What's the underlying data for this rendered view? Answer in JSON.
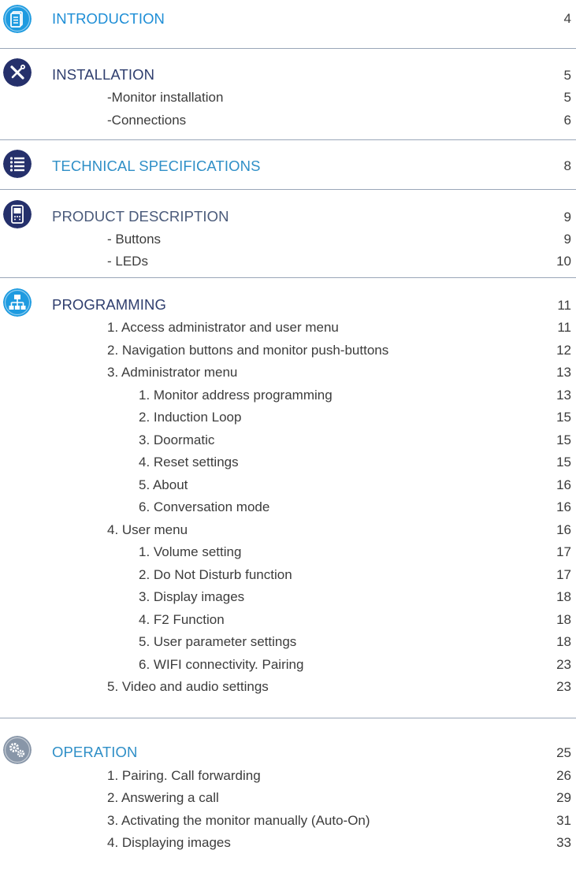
{
  "colors": {
    "introduction_icon": "#1e9be0",
    "installation_icon": "#25306b",
    "technical_icon": "#25306b",
    "product_icon": "#25306b",
    "programming_icon": "#1e9be0",
    "operation_icon": "#8896a8",
    "rule": "#9aa6b8"
  },
  "sections": {
    "introduction": {
      "icon": "document-icon",
      "title": "INTRODUCTION",
      "page": "4"
    },
    "installation": {
      "icon": "tools-icon",
      "title": "INSTALLATION",
      "page": "5",
      "items": [
        {
          "label": "-Monitor installation",
          "page": "5"
        },
        {
          "label": "-Connections",
          "page": "6"
        }
      ]
    },
    "technical": {
      "icon": "list-icon",
      "title": "TECHNICAL SPECIFICATIONS",
      "page": "8"
    },
    "product": {
      "icon": "monitor-icon",
      "title": "PRODUCT DESCRIPTION",
      "page": "9",
      "items": [
        {
          "label": "- Buttons",
          "page": "9"
        },
        {
          "label": "- LEDs",
          "page": "10"
        }
      ]
    },
    "programming": {
      "icon": "network-icon",
      "title": "PROGRAMMING",
      "page": "11",
      "items": [
        {
          "label": "1. Access administrator and user menu",
          "page": "11"
        },
        {
          "label": "2. Navigation buttons and monitor push-buttons",
          "page": "12"
        },
        {
          "label": "3. Administrator menu",
          "page": "13"
        },
        {
          "label": "1. Monitor address programming",
          "page": "13"
        },
        {
          "label": "2. Induction Loop",
          "page": "15"
        },
        {
          "label": "3. Doormatic",
          "page": "15"
        },
        {
          "label": "4. Reset settings",
          "page": "15"
        },
        {
          "label": "5. About",
          "page": "16"
        },
        {
          "label": "6. Conversation mode",
          "page": "16"
        },
        {
          "label": "4. User menu",
          "page": "16"
        },
        {
          "label": "1. Volume setting",
          "page": "17"
        },
        {
          "label": "2. Do Not Disturb function",
          "page": "17"
        },
        {
          "label": "3. Display images",
          "page": "18"
        },
        {
          "label": "4. F2 Function",
          "page": "18"
        },
        {
          "label": "5. User parameter settings",
          "page": "18"
        },
        {
          "label": "6. WIFI connectivity. Pairing",
          "page": "23"
        },
        {
          "label": "5. Video and audio settings",
          "page": "23"
        }
      ]
    },
    "operation": {
      "icon": "gears-icon",
      "title": "OPERATION",
      "page": "25",
      "items": [
        {
          "label": "1. Pairing. Call forwarding",
          "page": "26"
        },
        {
          "label": "2. Answering a call",
          "page": "29"
        },
        {
          "label": "3. Activating the monitor manually (Auto-On)",
          "page": "31"
        },
        {
          "label": "4. Displaying images",
          "page": "33"
        }
      ]
    }
  }
}
